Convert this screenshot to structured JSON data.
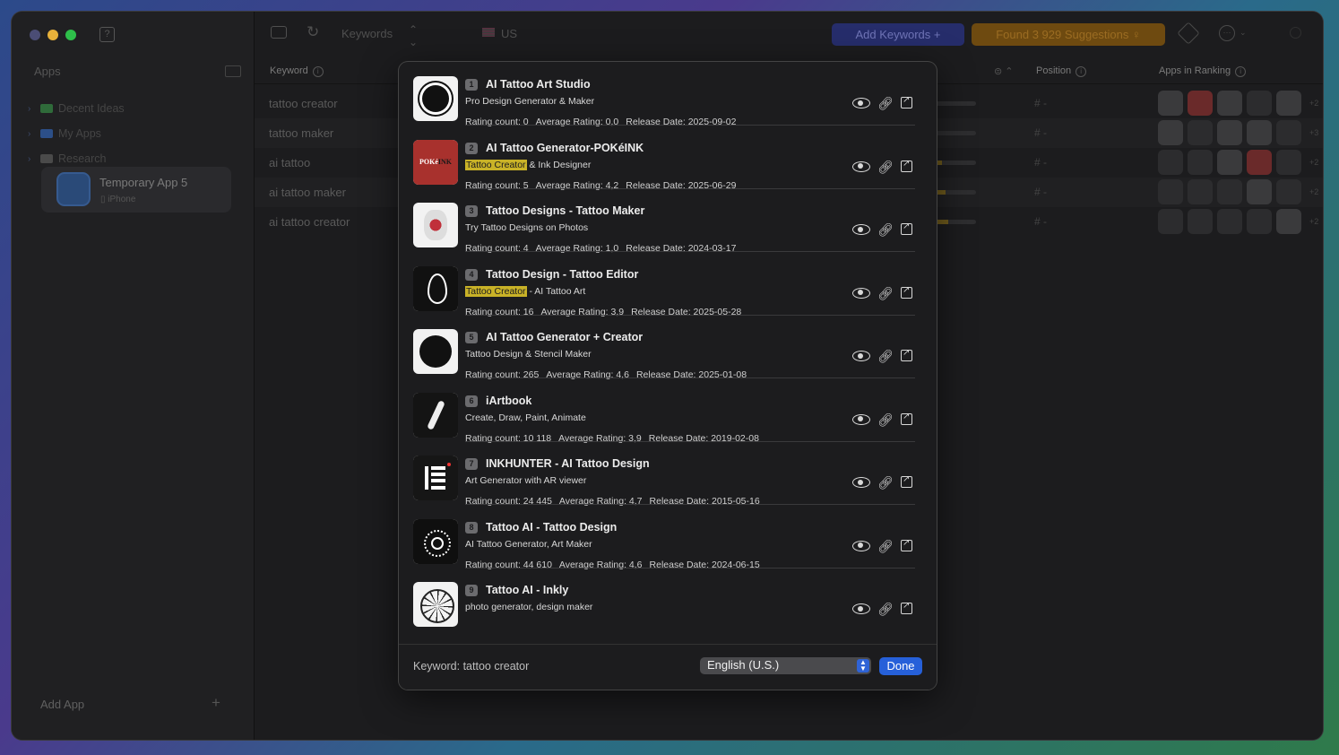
{
  "sidebar": {
    "section_title": "Apps",
    "folders": [
      {
        "label": "Decent Ideas",
        "color": "green"
      },
      {
        "label": "My Apps",
        "color": "blue"
      },
      {
        "label": "Research",
        "color": "grey"
      }
    ],
    "selected_app": {
      "name": "Temporary App 5",
      "platform": "iPhone"
    },
    "add_app_label": "Add App"
  },
  "toolbar": {
    "mode_label": "Keywords",
    "country": "US",
    "add_keywords_label": "Add Keywords",
    "found_label": "Found 3 929 Suggestions"
  },
  "table": {
    "headers": {
      "keyword": "Keyword",
      "position": "Position",
      "apps_in_ranking": "Apps in Ranking"
    },
    "rows": [
      {
        "keyword": "tattoo creator",
        "position": "#  -",
        "more": "+2",
        "bar": 0.0
      },
      {
        "keyword": "tattoo maker",
        "position": "#  -",
        "more": "+3",
        "bar": 0.0
      },
      {
        "keyword": "ai tattoo",
        "position": "#  -",
        "more": "+2",
        "bar": 0.15
      },
      {
        "keyword": "ai tattoo maker",
        "position": "#  -",
        "more": "+2",
        "bar": 0.25
      },
      {
        "keyword": "ai tattoo creator",
        "position": "#  -",
        "more": "+2",
        "bar": 0.3
      }
    ]
  },
  "popover": {
    "items": [
      {
        "n": "1",
        "title": "AI Tattoo Art Studio",
        "sub_pre": "",
        "sub_mark": "",
        "sub_post": "Pro Design Generator & Maker",
        "rating_count": "Rating count: 0",
        "avg": "Average Rating: 0,0",
        "release": "Release Date: 2025-09-02"
      },
      {
        "n": "2",
        "title": "AI Tattoo Generator-POKéINK",
        "sub_pre": "",
        "sub_mark": "Tattoo Creator",
        "sub_post": " & Ink Designer",
        "rating_count": "Rating count: 5",
        "avg": "Average Rating: 4,2",
        "release": "Release Date: 2025-06-29"
      },
      {
        "n": "3",
        "title": "Tattoo Designs - Tattoo Maker",
        "sub_pre": "",
        "sub_mark": "",
        "sub_post": "Try Tattoo Designs on Photos",
        "rating_count": "Rating count: 4",
        "avg": "Average Rating: 1,0",
        "release": "Release Date: 2024-03-17"
      },
      {
        "n": "4",
        "title": "Tattoo Design - Tattoo Editor",
        "sub_pre": "",
        "sub_mark": "Tattoo Creator",
        "sub_post": " - AI Tattoo Art",
        "rating_count": "Rating count: 16",
        "avg": "Average Rating: 3,9",
        "release": "Release Date: 2025-05-28"
      },
      {
        "n": "5",
        "title": "AI Tattoo Generator + Creator",
        "sub_pre": "",
        "sub_mark": "",
        "sub_post": "Tattoo Design & Stencil Maker",
        "rating_count": "Rating count: 265",
        "avg": "Average Rating: 4,6",
        "release": "Release Date: 2025-01-08"
      },
      {
        "n": "6",
        "title": "iArtbook",
        "sub_pre": "",
        "sub_mark": "",
        "sub_post": "Create, Draw, Paint, Animate",
        "rating_count": "Rating count: 10 118",
        "avg": "Average Rating: 3,9",
        "release": "Release Date: 2019-02-08"
      },
      {
        "n": "7",
        "title": "INKHUNTER - AI Tattoo Design",
        "sub_pre": "",
        "sub_mark": "",
        "sub_post": "Art Generator with AR viewer",
        "rating_count": "Rating count: 24 445",
        "avg": "Average Rating: 4,7",
        "release": "Release Date: 2015-05-16"
      },
      {
        "n": "8",
        "title": "Tattoo AI - Tattoo Design",
        "sub_pre": "",
        "sub_mark": "",
        "sub_post": "AI Tattoo Generator, Art Maker",
        "rating_count": "Rating count: 44 610",
        "avg": "Average Rating: 4,6",
        "release": "Release Date: 2024-06-15"
      },
      {
        "n": "9",
        "title": "Tattoo AI - Inkly",
        "sub_pre": "",
        "sub_mark": "",
        "sub_post": "photo generator, design maker",
        "rating_count": "",
        "avg": "",
        "release": ""
      }
    ],
    "footer": {
      "keyword_label": "Keyword: tattoo creator",
      "language": "English (U.S.)",
      "done_label": "Done"
    }
  }
}
